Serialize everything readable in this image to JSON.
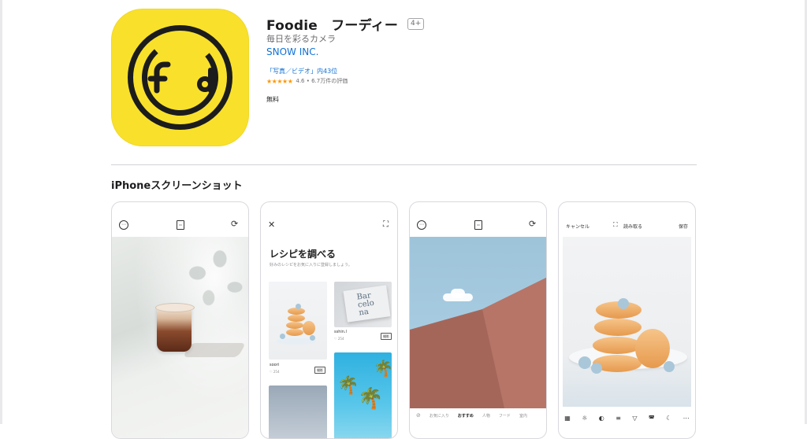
{
  "app": {
    "title": "Foodie　フーディー",
    "age_rating": "4+",
    "subtitle": "毎日を彩るカメラ",
    "developer": "SNOW INC.",
    "rank": "「写真／ビデオ」内43位",
    "stars": "★★★★★",
    "rating_text": "4.6 • 6.7万件の評価",
    "price": "無料"
  },
  "colors": {
    "icon_yellow": "#f9e12b",
    "link_blue": "#1171d6",
    "star_orange": "#ff9500"
  },
  "section": {
    "title": "iPhoneスクリーンショット"
  },
  "screenshots": {
    "shot1": {
      "icons": [
        "more-icon",
        "album-icon",
        "switch-camera-icon"
      ]
    },
    "shot2": {
      "title": "レシピを調べる",
      "subtitle": "好みのレシピをお気に入りに登録しましょう。",
      "book_text": "Bar\ncelo\nna",
      "user1": "soori",
      "count1": "♡ 254",
      "save1": "撮影",
      "user2": "sshin.l",
      "count2": "♡ 254",
      "save2": "撮影"
    },
    "shot3": {
      "filters": [
        "お気に入り",
        "おすすめ",
        "人物",
        "フード",
        "室内"
      ],
      "active_filter": "おすすめ"
    },
    "shot4": {
      "cancel": "キャンセル",
      "scan": "読み取る",
      "save": "保存",
      "tools": [
        "▦",
        "☼",
        "◐",
        "≡",
        "▽",
        "◚",
        "☾",
        "⋯"
      ]
    }
  }
}
